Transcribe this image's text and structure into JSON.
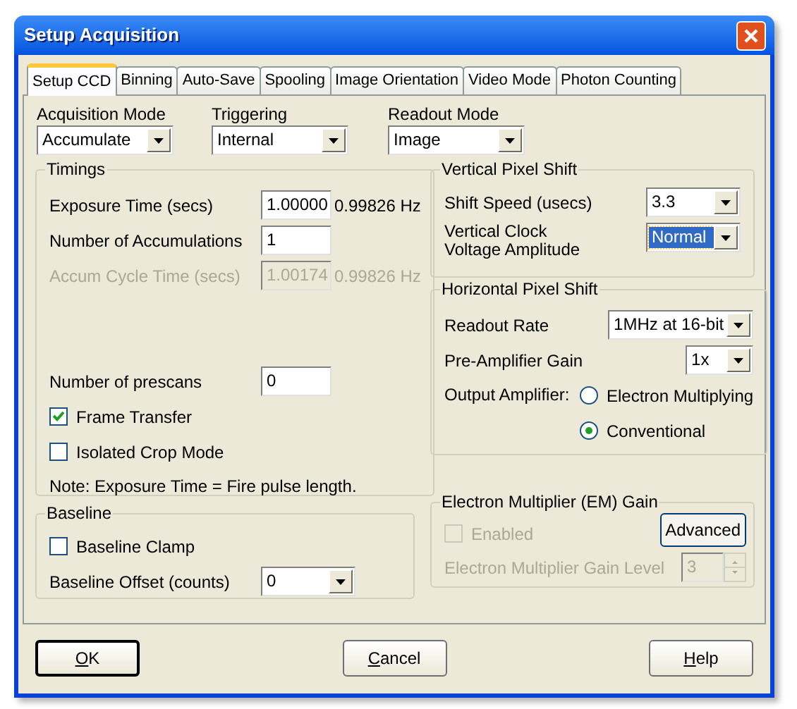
{
  "window": {
    "title": "Setup Acquisition"
  },
  "tabs": [
    {
      "label": "Setup CCD",
      "selected": true
    },
    {
      "label": "Binning",
      "selected": false
    },
    {
      "label": "Auto-Save",
      "selected": false
    },
    {
      "label": "Spooling",
      "selected": false
    },
    {
      "label": "Image Orientation",
      "selected": false
    },
    {
      "label": "Video Mode",
      "selected": false
    },
    {
      "label": "Photon Counting",
      "selected": false
    }
  ],
  "top_fields": [
    {
      "label": "Acquisition Mode",
      "value": "Accumulate"
    },
    {
      "label": "Triggering",
      "value": "Internal"
    },
    {
      "label": "Readout Mode",
      "value": "Image"
    }
  ],
  "timings": {
    "title": "Timings",
    "rows": [
      {
        "label": "Exposure Time (secs)",
        "value": "1.00000",
        "reading": "0.99826 Hz",
        "disabled": false
      },
      {
        "label": "Number of Accumulations",
        "value": "1",
        "disabled": false
      },
      {
        "label": "Accum Cycle Time (secs)",
        "value": "1.00174",
        "reading": "0.99826 Hz",
        "disabled": true
      }
    ],
    "prescans": {
      "label": "Number of prescans",
      "value": "0"
    },
    "checkboxes": [
      {
        "label": "Frame Transfer",
        "checked": true
      },
      {
        "label": "Isolated Crop Mode",
        "checked": false
      }
    ],
    "note": "Note: Exposure Time = Fire pulse length."
  },
  "baseline": {
    "title": "Baseline",
    "clamp": {
      "label": "Baseline Clamp",
      "checked": false
    },
    "offset": {
      "label": "Baseline Offset (counts)",
      "value": "0"
    }
  },
  "vertical_pixel_shift": {
    "title": "Vertical Pixel Shift",
    "shift_speed": {
      "label": "Shift Speed (usecs)",
      "value": "3.3",
      "focused": false
    },
    "clock_voltage": {
      "label": "Vertical Clock\nVoltage Amplitude",
      "value": "Normal",
      "focused": true
    }
  },
  "horizontal_pixel_shift": {
    "title": "Horizontal Pixel Shift",
    "readout_rate": {
      "label": "Readout Rate",
      "value": "1MHz at 16-bit"
    },
    "preamp_gain": {
      "label": "Pre-Amplifier Gain",
      "value": "1x"
    },
    "output_amplifier": {
      "label": "Output Amplifier:",
      "options": [
        {
          "label": "Electron Multiplying",
          "selected": false
        },
        {
          "label": "Conventional",
          "selected": true
        }
      ]
    }
  },
  "em_gain": {
    "title": "Electron Multiplier (EM) Gain",
    "enabled": {
      "label": "Enabled",
      "checked": false,
      "disabled": true
    },
    "advanced_button": "Advanced",
    "gain_level": {
      "label": "Electron Multiplier Gain Level",
      "value": "3",
      "disabled": true
    }
  },
  "buttons": [
    {
      "label": "OK",
      "default": true
    },
    {
      "label": "Cancel",
      "default": false
    },
    {
      "label": "Help",
      "default": false
    }
  ]
}
